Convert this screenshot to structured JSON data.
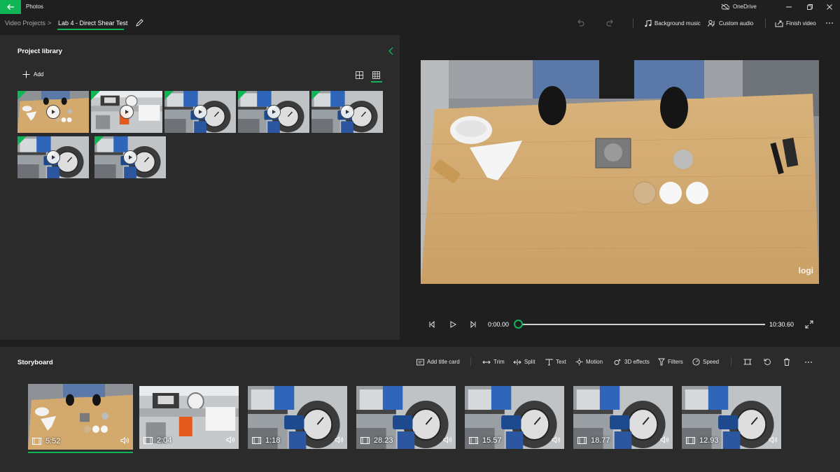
{
  "titlebar": {
    "app_title": "Photos",
    "onedrive_label": "OneDrive",
    "back_icon": "arrow-left-icon",
    "accent": "#10b556"
  },
  "breadcrumb": {
    "root": "Video Projects",
    "separator": ">",
    "current": "Lab 4 - Direct Shear Test"
  },
  "toolbar": {
    "background_music": "Background music",
    "custom_audio": "Custom audio",
    "finish_video": "Finish video"
  },
  "library": {
    "title": "Project library",
    "add_label": "Add",
    "items": [
      {
        "scene": "table",
        "has_tag": true
      },
      {
        "scene": "machine-orange",
        "has_tag": true
      },
      {
        "scene": "gauge",
        "has_tag": true
      },
      {
        "scene": "gauge",
        "has_tag": true
      },
      {
        "scene": "gauge",
        "has_tag": true
      },
      {
        "scene": "gauge",
        "has_tag": true
      },
      {
        "scene": "gauge",
        "has_tag": true
      }
    ]
  },
  "preview": {
    "watermark": "logi"
  },
  "playback": {
    "current_time": "0:00.00",
    "total_time": "10:30.60",
    "progress": 0
  },
  "storyboard": {
    "title": "Storyboard",
    "tools": {
      "add_title_card": "Add title card",
      "trim": "Trim",
      "split": "Split",
      "text": "Text",
      "motion": "Motion",
      "effects_3d": "3D effects",
      "filters": "Filters",
      "speed": "Speed"
    },
    "clips": [
      {
        "duration": "5:52",
        "scene": "table",
        "selected": true
      },
      {
        "duration": "2:04",
        "scene": "machine-orange",
        "selected": false
      },
      {
        "duration": "1:18",
        "scene": "gauge",
        "selected": false
      },
      {
        "duration": "28.23",
        "scene": "gauge",
        "selected": false
      },
      {
        "duration": "15.57",
        "scene": "gauge",
        "selected": false
      },
      {
        "duration": "18.77",
        "scene": "gauge",
        "selected": false
      },
      {
        "duration": "12.93",
        "scene": "gauge",
        "selected": false
      }
    ]
  }
}
